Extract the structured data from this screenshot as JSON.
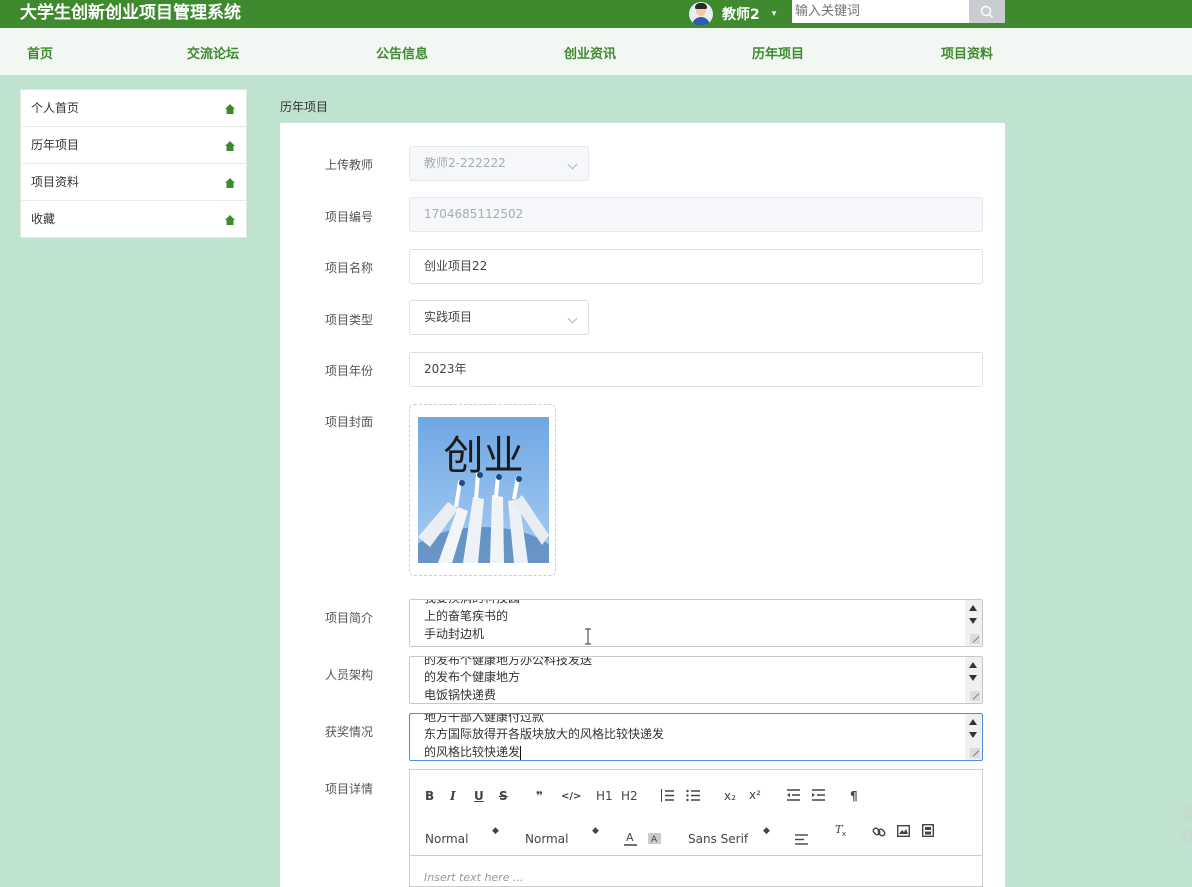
{
  "app": {
    "title": "大学生创新创业项目管理系统"
  },
  "user": {
    "name": "教师2",
    "caret": "▾"
  },
  "search": {
    "placeholder": "输入关键词",
    "value": ""
  },
  "nav": [
    {
      "label": "首页"
    },
    {
      "label": "交流论坛"
    },
    {
      "label": "公告信息"
    },
    {
      "label": "创业资讯"
    },
    {
      "label": "历年项目"
    },
    {
      "label": "项目资料"
    }
  ],
  "sidebar": [
    {
      "label": "个人首页",
      "icon": "home-icon"
    },
    {
      "label": "历年项目",
      "icon": "home-icon"
    },
    {
      "label": "项目资料",
      "icon": "home-icon"
    },
    {
      "label": "收藏",
      "icon": "home-icon"
    }
  ],
  "breadcrumb": "历年项目",
  "form": {
    "teacher": {
      "label": "上传教师",
      "value": "教师2-222222"
    },
    "code": {
      "label": "项目编号",
      "value": "1704685112502"
    },
    "name": {
      "label": "项目名称",
      "value": "创业项目22"
    },
    "type": {
      "label": "项目类型",
      "value": "实践项目"
    },
    "year": {
      "label": "项目年份",
      "value": "2023年"
    },
    "cover": {
      "label": "项目封面",
      "image_text": "创业"
    },
    "intro": {
      "label": "项目简介",
      "lines": [
        "我要疾病的科技园",
        "上的奋笔疾书的",
        "手动封边机"
      ]
    },
    "staff": {
      "label": "人员架构",
      "lines": [
        "的发布个健康地方办公科技发送",
        "的发布个健康地方",
        "电饭锅快递费"
      ]
    },
    "awards": {
      "label": "获奖情况",
      "lines": [
        "地方干部入健康付过款",
        "东方国际放得开各版块放大的风格比较快递发",
        "的风格比较快递发"
      ]
    },
    "details": {
      "label": "项目详情",
      "placeholder": "Insert text here ...",
      "toolbar_row1": [
        "B",
        "I",
        "U",
        "S",
        "❞",
        "</>",
        "H1",
        "H2",
        "ol",
        "ul",
        "x₂",
        "x²",
        "outdent",
        "indent",
        "¶"
      ],
      "select_size": "Normal",
      "select_header": "Normal",
      "select_font": "Sans Serif"
    }
  },
  "watermark": "激\n转",
  "colors": {
    "brand": "#3f8a2f",
    "page_bg": "#bfe3cf",
    "nav_bg": "#f2f7f4"
  }
}
